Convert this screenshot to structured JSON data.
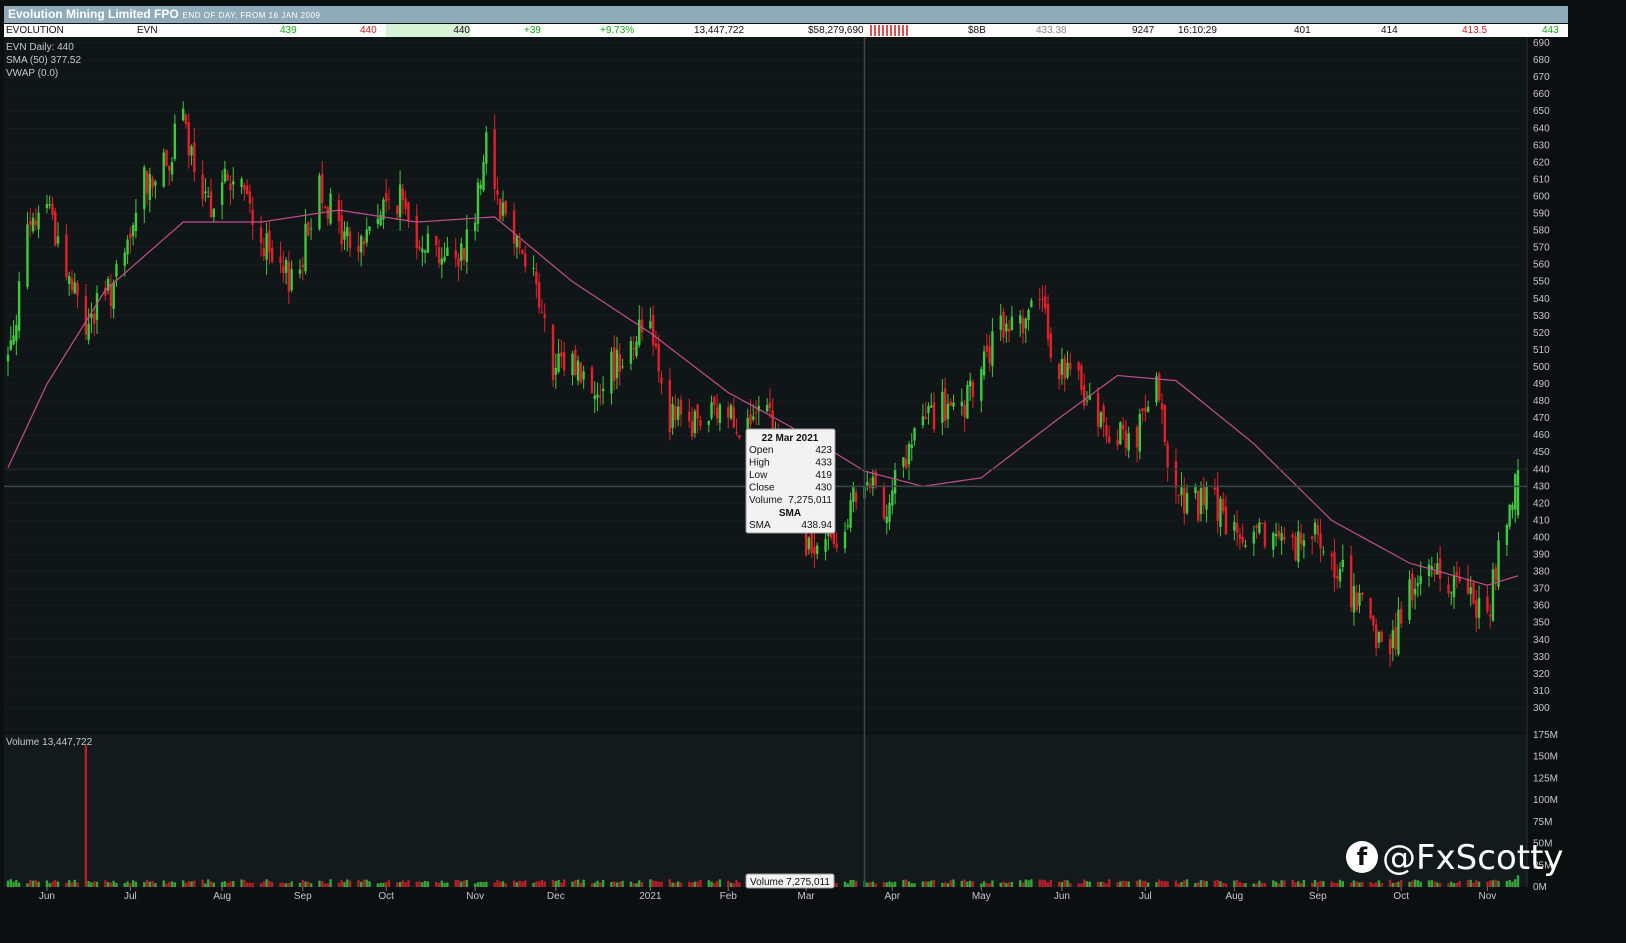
{
  "header": {
    "title": "Evolution Mining Limited FPO",
    "subtitle": "END OF DAY, FROM 16 JAN 2009"
  },
  "quote_row": {
    "name": "EVOLUTION",
    "code": "EVN",
    "bid": "439",
    "offer": "440",
    "last": "440",
    "change": "+39",
    "change_pct": "+9.73%",
    "volume": "13,447,722",
    "value": "$58,279,690",
    "market_cap": "$8B",
    "vwap": "433.38",
    "trades": "9247",
    "time": "16:10:29",
    "open": "401",
    "high": "414",
    "low": "413.5",
    "close": "443"
  },
  "legend": {
    "line1": "EVN Daily: 440",
    "line2": "SMA (50) 377.52",
    "line3": "VWAP (0.0)",
    "volume_label": "Volume 13,447,722"
  },
  "tooltip": {
    "date": "22 Mar 2021",
    "rows": [
      {
        "k": "Open",
        "v": "423"
      },
      {
        "k": "High",
        "v": "433"
      },
      {
        "k": "Low",
        "v": "419"
      },
      {
        "k": "Close",
        "v": "430"
      },
      {
        "k": "Volume",
        "v": "7,275,011"
      }
    ],
    "sma_header": "SMA",
    "sma_label": "SMA",
    "sma_value": "438.94",
    "volume_tag": "Volume 7,275,011"
  },
  "watermark": "@FxScotty",
  "colors": {
    "up": "#3ec93e",
    "down": "#e0202a",
    "sma": "#c0508c",
    "background": "#101617",
    "grid": "#1b2426"
  },
  "chart_data": {
    "type": "candlestick",
    "title": "Evolution Mining Limited FPO",
    "x_tick_labels": [
      "Jun",
      "Jul",
      "Aug",
      "Sep",
      "Oct",
      "Nov",
      "Dec",
      "2021",
      "Feb",
      "Mar",
      "Apr",
      "May",
      "Jun",
      "Jul",
      "Aug",
      "Sep",
      "Oct",
      "Nov"
    ],
    "price_axis": {
      "min": 300,
      "max": 690,
      "step": 10
    },
    "volume_axis": {
      "labels": [
        "0M",
        "25M",
        "50M",
        "75M",
        "100M",
        "125M",
        "150M",
        "175M"
      ],
      "max": 175
    },
    "close_anchors": [
      {
        "date": "2020-05-18",
        "close": 505
      },
      {
        "date": "2020-05-25",
        "close": 575
      },
      {
        "date": "2020-06-01",
        "close": 600
      },
      {
        "date": "2020-06-08",
        "close": 555
      },
      {
        "date": "2020-06-15",
        "close": 525
      },
      {
        "date": "2020-06-22",
        "close": 540
      },
      {
        "date": "2020-06-29",
        "close": 560
      },
      {
        "date": "2020-07-06",
        "close": 610
      },
      {
        "date": "2020-07-13",
        "close": 615
      },
      {
        "date": "2020-07-20",
        "close": 645
      },
      {
        "date": "2020-07-27",
        "close": 590
      },
      {
        "date": "2020-08-03",
        "close": 610
      },
      {
        "date": "2020-08-10",
        "close": 605
      },
      {
        "date": "2020-08-17",
        "close": 575
      },
      {
        "date": "2020-08-24",
        "close": 550
      },
      {
        "date": "2020-08-31",
        "close": 560
      },
      {
        "date": "2020-09-07",
        "close": 610
      },
      {
        "date": "2020-09-14",
        "close": 580
      },
      {
        "date": "2020-09-21",
        "close": 570
      },
      {
        "date": "2020-09-28",
        "close": 590
      },
      {
        "date": "2020-10-05",
        "close": 600
      },
      {
        "date": "2020-10-12",
        "close": 580
      },
      {
        "date": "2020-10-19",
        "close": 570
      },
      {
        "date": "2020-10-26",
        "close": 560
      },
      {
        "date": "2020-11-02",
        "close": 590
      },
      {
        "date": "2020-11-06",
        "close": 640
      },
      {
        "date": "2020-11-10",
        "close": 600
      },
      {
        "date": "2020-11-16",
        "close": 580
      },
      {
        "date": "2020-11-23",
        "close": 555
      },
      {
        "date": "2020-11-30",
        "close": 495
      },
      {
        "date": "2020-12-07",
        "close": 505
      },
      {
        "date": "2020-12-14",
        "close": 485
      },
      {
        "date": "2020-12-21",
        "close": 500
      },
      {
        "date": "2021-01-04",
        "close": 530
      },
      {
        "date": "2021-01-11",
        "close": 470
      },
      {
        "date": "2021-01-18",
        "close": 465
      },
      {
        "date": "2021-01-25",
        "close": 470
      },
      {
        "date": "2021-02-01",
        "close": 475
      },
      {
        "date": "2021-02-08",
        "close": 465
      },
      {
        "date": "2021-02-15",
        "close": 470
      },
      {
        "date": "2021-02-22",
        "close": 440
      },
      {
        "date": "2021-03-01",
        "close": 390
      },
      {
        "date": "2021-03-08",
        "close": 395
      },
      {
        "date": "2021-03-15",
        "close": 410
      },
      {
        "date": "2021-03-22",
        "close": 430
      },
      {
        "date": "2021-03-29",
        "close": 420
      },
      {
        "date": "2021-04-06",
        "close": 445
      },
      {
        "date": "2021-04-12",
        "close": 470
      },
      {
        "date": "2021-04-19",
        "close": 475
      },
      {
        "date": "2021-04-26",
        "close": 470
      },
      {
        "date": "2021-05-03",
        "close": 500
      },
      {
        "date": "2021-05-10",
        "close": 520
      },
      {
        "date": "2021-05-17",
        "close": 530
      },
      {
        "date": "2021-05-24",
        "close": 535
      },
      {
        "date": "2021-05-31",
        "close": 500
      },
      {
        "date": "2021-06-07",
        "close": 490
      },
      {
        "date": "2021-06-14",
        "close": 470
      },
      {
        "date": "2021-06-21",
        "close": 460
      },
      {
        "date": "2021-06-28",
        "close": 460
      },
      {
        "date": "2021-07-05",
        "close": 485
      },
      {
        "date": "2021-07-12",
        "close": 425
      },
      {
        "date": "2021-07-19",
        "close": 420
      },
      {
        "date": "2021-07-26",
        "close": 420
      },
      {
        "date": "2021-08-02",
        "close": 400
      },
      {
        "date": "2021-08-09",
        "close": 395
      },
      {
        "date": "2021-08-16",
        "close": 405
      },
      {
        "date": "2021-08-23",
        "close": 395
      },
      {
        "date": "2021-08-30",
        "close": 400
      },
      {
        "date": "2021-09-06",
        "close": 385
      },
      {
        "date": "2021-09-13",
        "close": 370
      },
      {
        "date": "2021-09-20",
        "close": 345
      },
      {
        "date": "2021-09-27",
        "close": 335
      },
      {
        "date": "2021-10-04",
        "close": 370
      },
      {
        "date": "2021-10-11",
        "close": 380
      },
      {
        "date": "2021-10-18",
        "close": 375
      },
      {
        "date": "2021-10-25",
        "close": 370
      },
      {
        "date": "2021-11-01",
        "close": 355
      },
      {
        "date": "2021-11-05",
        "close": 390
      },
      {
        "date": "2021-11-10",
        "close": 415
      },
      {
        "date": "2021-11-12",
        "close": 440
      }
    ],
    "sma50_anchors": [
      {
        "date": "2020-05-18",
        "close": 441
      },
      {
        "date": "2020-06-01",
        "close": 490
      },
      {
        "date": "2020-06-22",
        "close": 545
      },
      {
        "date": "2020-07-20",
        "close": 585
      },
      {
        "date": "2020-08-17",
        "close": 585
      },
      {
        "date": "2020-09-14",
        "close": 592
      },
      {
        "date": "2020-10-12",
        "close": 585
      },
      {
        "date": "2020-11-09",
        "close": 588
      },
      {
        "date": "2020-12-07",
        "close": 550
      },
      {
        "date": "2021-01-04",
        "close": 520
      },
      {
        "date": "2021-02-01",
        "close": 485
      },
      {
        "date": "2021-03-01",
        "close": 460
      },
      {
        "date": "2021-03-22",
        "close": 438.94
      },
      {
        "date": "2021-04-12",
        "close": 430
      },
      {
        "date": "2021-05-03",
        "close": 435
      },
      {
        "date": "2021-05-31",
        "close": 470
      },
      {
        "date": "2021-06-21",
        "close": 495
      },
      {
        "date": "2021-07-12",
        "close": 492
      },
      {
        "date": "2021-08-09",
        "close": 455
      },
      {
        "date": "2021-09-06",
        "close": 410
      },
      {
        "date": "2021-10-04",
        "close": 385
      },
      {
        "date": "2021-11-01",
        "close": 372
      },
      {
        "date": "2021-11-12",
        "close": 377.52
      }
    ],
    "volume_spike": {
      "date": "2020-06-15",
      "volume_m": 163
    },
    "highlight": {
      "date": "2021-03-22",
      "open": 423,
      "high": 433,
      "low": 419,
      "close": 430,
      "volume": 7275011,
      "sma": 438.94
    }
  }
}
